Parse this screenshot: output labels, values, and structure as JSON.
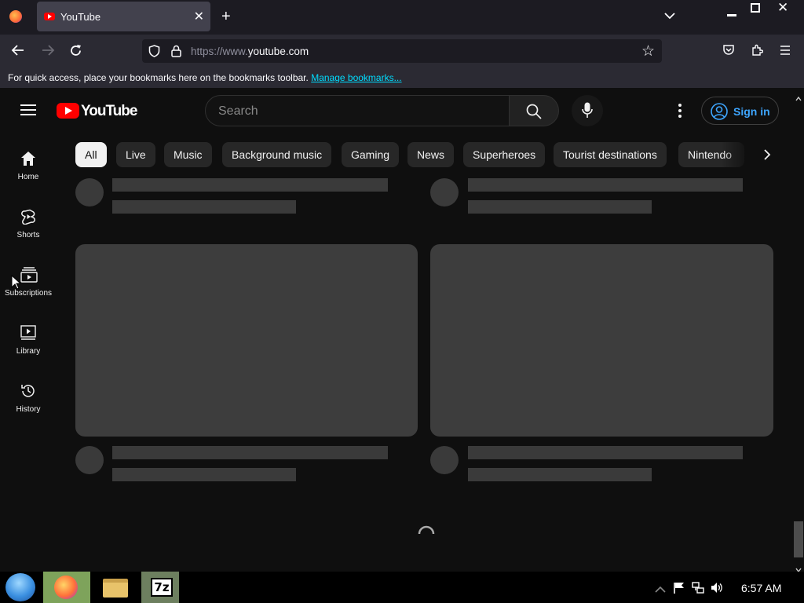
{
  "browser": {
    "tab_title": "YouTube",
    "url_prefix": "https://www.",
    "url_domain": "youtube.com",
    "bookmarks_text": "For quick access, place your bookmarks here on the bookmarks toolbar.",
    "bookmarks_link": "Manage bookmarks..."
  },
  "youtube": {
    "logo_text": "YouTube",
    "search_placeholder": "Search",
    "signin_label": "Sign in",
    "chips": [
      "All",
      "Live",
      "Music",
      "Background music",
      "Gaming",
      "News",
      "Superheroes",
      "Tourist destinations",
      "Nintendo"
    ],
    "sidebar": [
      {
        "label": "Home",
        "icon": "home-icon"
      },
      {
        "label": "Shorts",
        "icon": "shorts-icon"
      },
      {
        "label": "Subscriptions",
        "icon": "subscriptions-icon"
      },
      {
        "label": "Library",
        "icon": "library-icon"
      },
      {
        "label": "History",
        "icon": "history-icon"
      }
    ]
  },
  "taskbar": {
    "clock": "6:57 AM",
    "apps": [
      "start-orb",
      "firefox",
      "file-manager",
      "7zip"
    ],
    "zip_label": "7z"
  },
  "colors": {
    "yt_red": "#ff0000",
    "link_blue": "#3ea6ff",
    "bg": "#0f0f0f"
  }
}
